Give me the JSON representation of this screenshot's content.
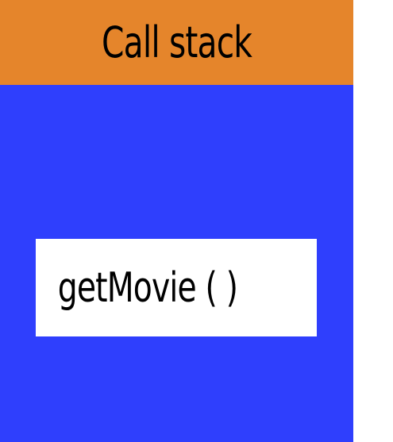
{
  "call_stack": {
    "title": "Call stack",
    "frames": [
      {
        "label": "getMovie ( )"
      }
    ]
  },
  "colors": {
    "header": "#e5852b",
    "stack_body": "#2f3ffd",
    "frame": "#ffffff",
    "text": "#000000"
  }
}
